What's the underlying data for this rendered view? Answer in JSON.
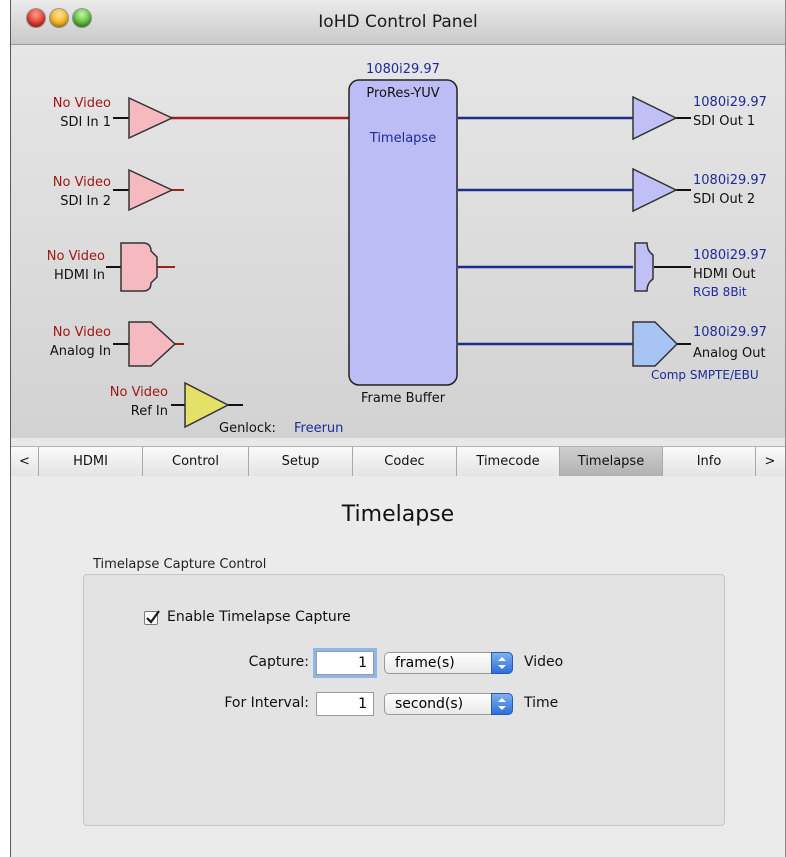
{
  "window": {
    "title": "IoHD Control Panel"
  },
  "diagram": {
    "inputs": [
      {
        "status": "No Video",
        "name": "SDI In 1"
      },
      {
        "status": "No Video",
        "name": "SDI In 2"
      },
      {
        "status": "No Video",
        "name": "HDMI In"
      },
      {
        "status": "No Video",
        "name": "Analog In"
      },
      {
        "status": "No Video",
        "name": "Ref In"
      }
    ],
    "genlock_label": "Genlock:",
    "genlock_value": "Freerun",
    "framebuffer": {
      "format": "1080i29.97",
      "codec": "ProRes-YUV",
      "mode": "Timelapse",
      "label": "Frame Buffer"
    },
    "outputs": [
      {
        "format": "1080i29.97",
        "name": "SDI Out 1",
        "detail": ""
      },
      {
        "format": "1080i29.97",
        "name": "SDI Out 2",
        "detail": ""
      },
      {
        "format": "1080i29.97",
        "name": "HDMI Out",
        "detail": "RGB 8Bit"
      },
      {
        "format": "1080i29.97",
        "name": "Analog Out",
        "detail": "Comp SMPTE/EBU"
      }
    ],
    "colors": {
      "input_line": "#a41d1d",
      "output_line": "#1e2e8a",
      "input_fill": "#f5b9bf",
      "output_fill": "#c0c0f6",
      "ref_fill": "#e5e06a",
      "buffer_fill": "#bdbdf5"
    }
  },
  "tabs": {
    "left_arrow": "<",
    "right_arrow": ">",
    "items": [
      "HDMI",
      "Control",
      "Setup",
      "Codec",
      "Timecode",
      "Timelapse",
      "Info"
    ],
    "selected": "Timelapse"
  },
  "panel": {
    "heading": "Timelapse",
    "group_label": "Timelapse Capture Control",
    "enable_label": "Enable Timelapse Capture",
    "enable_checked": true,
    "capture_label": "Capture:",
    "capture_value": "1",
    "capture_unit": "frame(s)",
    "capture_suffix": "Video",
    "interval_label": "For Interval:",
    "interval_value": "1",
    "interval_unit": "second(s)",
    "interval_suffix": "Time"
  }
}
